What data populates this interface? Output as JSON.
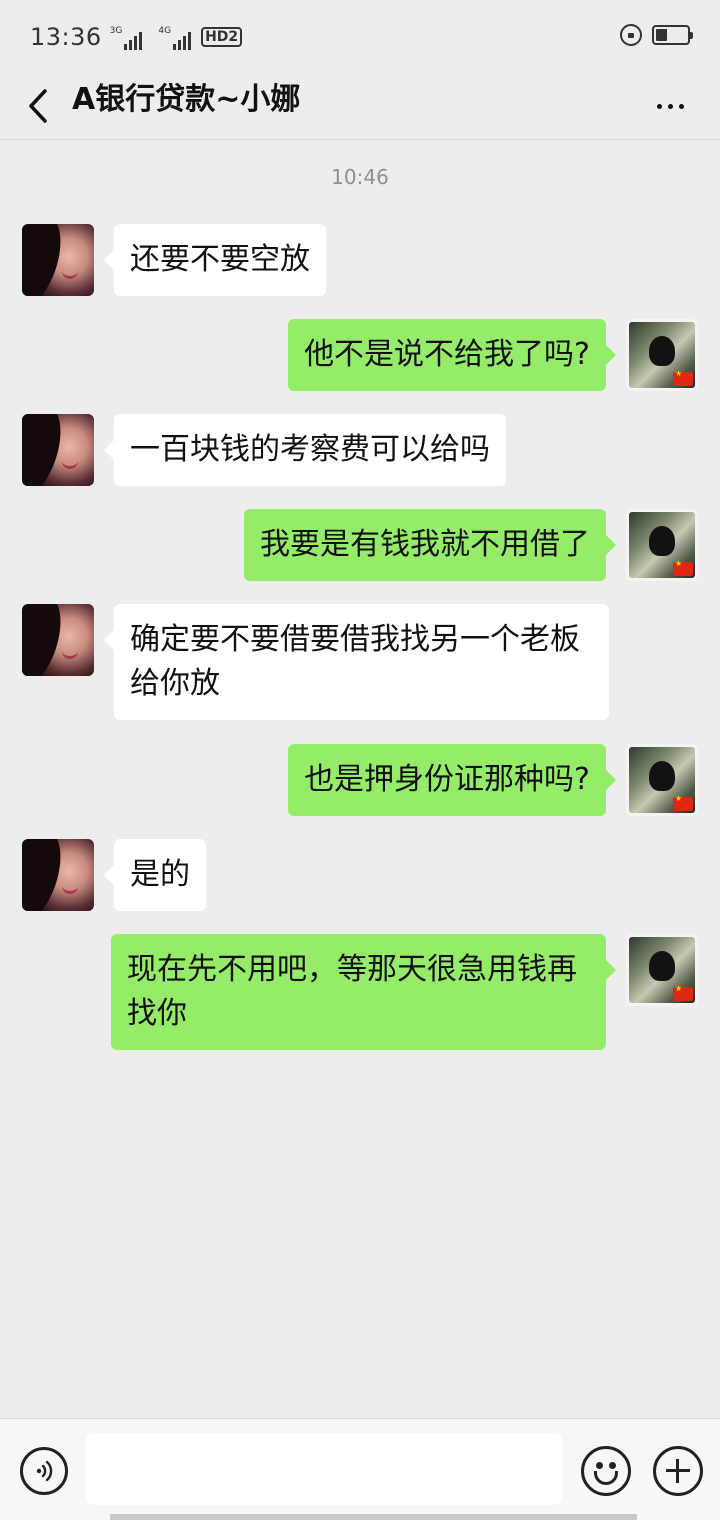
{
  "status_bar": {
    "time": "13:36",
    "net1": "3G",
    "net2": "4G",
    "hd": "HD2"
  },
  "header": {
    "title": "A银行贷款~小娜",
    "back_icon": "chevron-left-icon",
    "more_icon": "more-dots-icon"
  },
  "chat": {
    "timestamp": "10:46",
    "messages": [
      {
        "from": "them",
        "text": "还要不要空放"
      },
      {
        "from": "me",
        "text": "他不是说不给我了吗?"
      },
      {
        "from": "them",
        "text": "一百块钱的考察费可以给吗"
      },
      {
        "from": "me",
        "text": "我要是有钱我就不用借了"
      },
      {
        "from": "them",
        "text": "确定要不要借要借我找另一个老板给你放"
      },
      {
        "from": "me",
        "text": "也是押身份证那种吗?"
      },
      {
        "from": "them",
        "text": "是的"
      },
      {
        "from": "me",
        "text": "现在先不用吧，等那天很急用钱再找你"
      }
    ]
  },
  "input_bar": {
    "placeholder": "",
    "voice_icon": "voice-icon",
    "emoji_icon": "emoji-icon",
    "plus_icon": "plus-icon"
  },
  "colors": {
    "background": "#ededed",
    "my_bubble": "#95ec69",
    "their_bubble": "#ffffff"
  }
}
